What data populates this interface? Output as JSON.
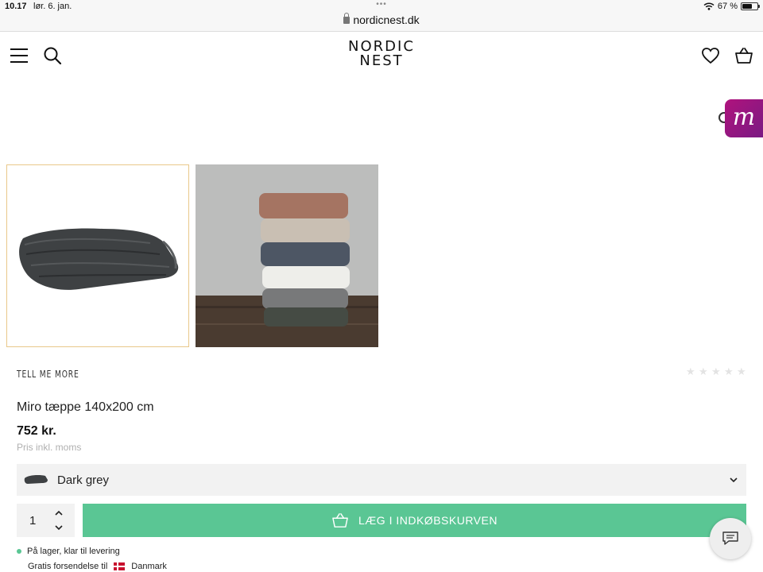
{
  "status_bar": {
    "time": "10.17",
    "date": "lør. 6. jan.",
    "dots": "•••",
    "url": "nordicnest.dk",
    "battery": "67 %",
    "battery_level": 0.67
  },
  "header": {
    "logo_line1": "NORDIC",
    "logo_line2": "NEST",
    "menu_icon": "hamburger-icon",
    "search_icon": "search-icon",
    "wishlist_icon": "heart-icon",
    "cart_icon": "basket-icon"
  },
  "badge": {
    "letter": "m"
  },
  "product": {
    "brand": "TELL ME MORE",
    "rating_stars": 5,
    "rating_filled": 0,
    "title": "Miro tæppe 140x200 cm",
    "price": "752 kr.",
    "price_note": "Pris inkl. moms",
    "variant": "Dark grey",
    "quantity": "1",
    "add_to_cart": "LÆG I INDKØBSKURVEN",
    "stock_status": "På lager, klar til levering",
    "shipping_text": "Gratis forsendelse til",
    "shipping_country": "Danmark"
  },
  "colors": {
    "accent_green": "#5ac694",
    "badge_purple": "#9c1580",
    "thumb_border": "#e9c88a"
  }
}
